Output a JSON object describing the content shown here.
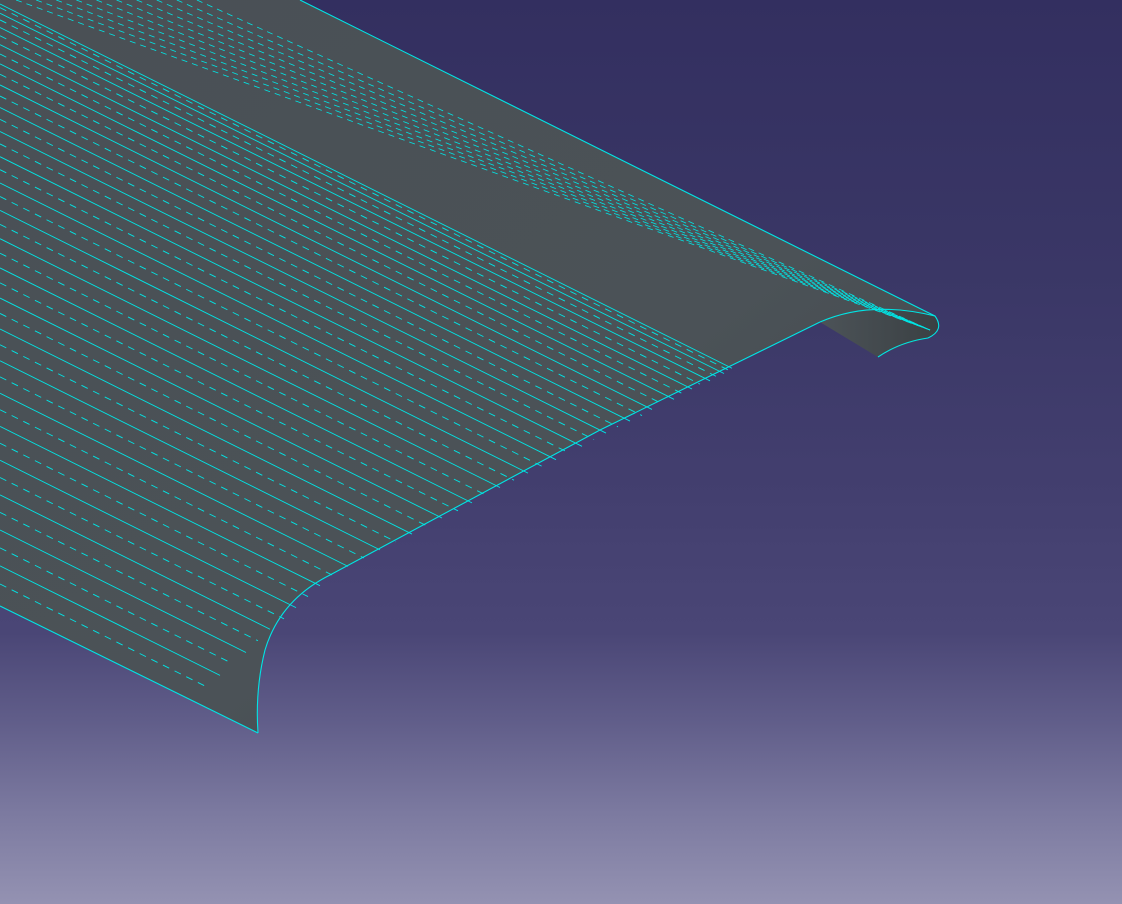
{
  "viewport": {
    "view": "3D",
    "background_top": "#332f60",
    "background_bottom": "#9492b2"
  },
  "model": {
    "shape": "wing-surface",
    "face_color": "#4a5156",
    "edge_color": "#00e5e5",
    "visible_edges": "solid",
    "hidden_edges": "dashed"
  }
}
